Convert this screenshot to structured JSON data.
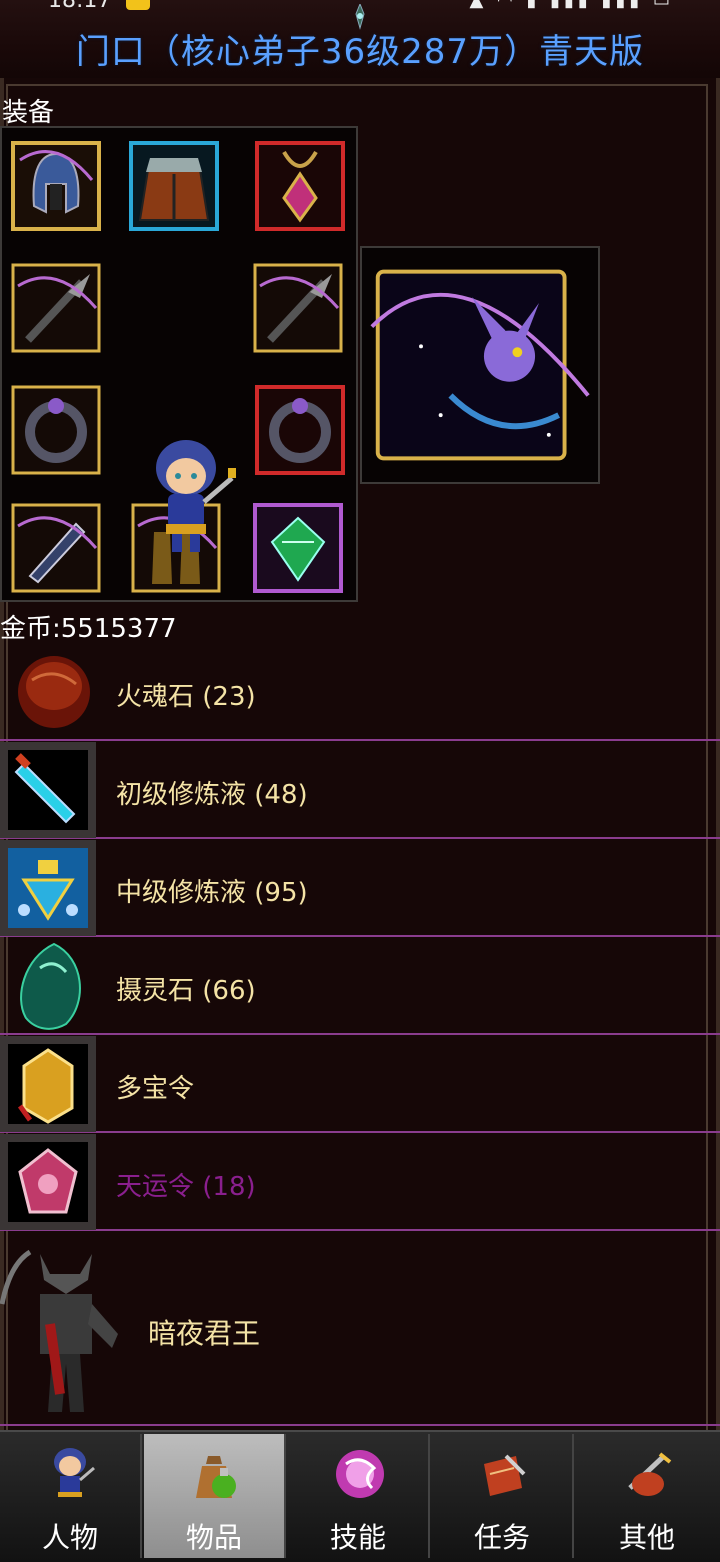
{
  "status_bar": {
    "time": "18:17"
  },
  "header": {
    "title": "门口（核心弟子36级287万）青天版"
  },
  "equipment": {
    "label": "装备"
  },
  "gold": {
    "text": "金币:5515377"
  },
  "items": [
    {
      "name": "火魂石 (23)",
      "icon": "fire-soul-stone-icon"
    },
    {
      "name": "初级修炼液 (48)",
      "icon": "blue-potion-icon"
    },
    {
      "name": "中级修炼液 (95)",
      "icon": "mid-potion-icon"
    },
    {
      "name": "摄灵石 (66)",
      "icon": "spirit-stone-icon"
    },
    {
      "name": "多宝令",
      "icon": "treasure-token-icon"
    },
    {
      "name": "天运令 (18)",
      "icon": "fortune-token-icon",
      "color": "#8a1f8e"
    }
  ],
  "boss": {
    "name": "暗夜君王"
  },
  "tabs": [
    {
      "label": "人物",
      "icon": "character-icon",
      "active": false
    },
    {
      "label": "物品",
      "icon": "bag-icon",
      "active": true
    },
    {
      "label": "技能",
      "icon": "skill-icon",
      "active": false
    },
    {
      "label": "任务",
      "icon": "quest-icon",
      "active": false
    },
    {
      "label": "其他",
      "icon": "other-icon",
      "active": false
    }
  ]
}
